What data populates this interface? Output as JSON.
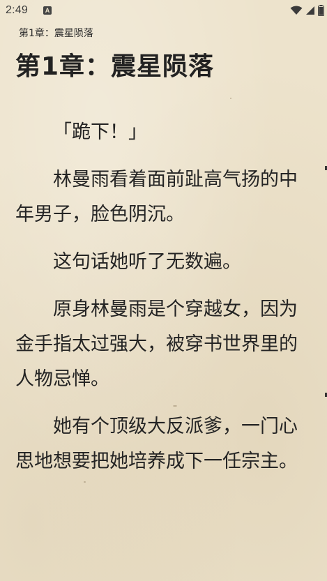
{
  "status_bar": {
    "time": "2:49",
    "app_icon_letter": "A",
    "icons": [
      "wifi-icon",
      "cellular-signal-icon",
      "battery-icon"
    ]
  },
  "header": {
    "chapter_label": "第1章：震星陨落"
  },
  "chapter": {
    "title": "第1章：震星陨落",
    "paragraphs": [
      "「跪下！」",
      "林曼雨看着面前趾高气扬的中年男子，脸色阴沉。",
      "这句话她听了无数遍。",
      "原身林曼雨是个穿越女，因为金手指太过强大，被穿书世界里的人物忌惮。",
      "她有个顶级大反派爹，一门心思地想要把她培养成下一任宗主。"
    ]
  },
  "colors": {
    "paper_background": "#ede3cc",
    "text": "#242424"
  }
}
